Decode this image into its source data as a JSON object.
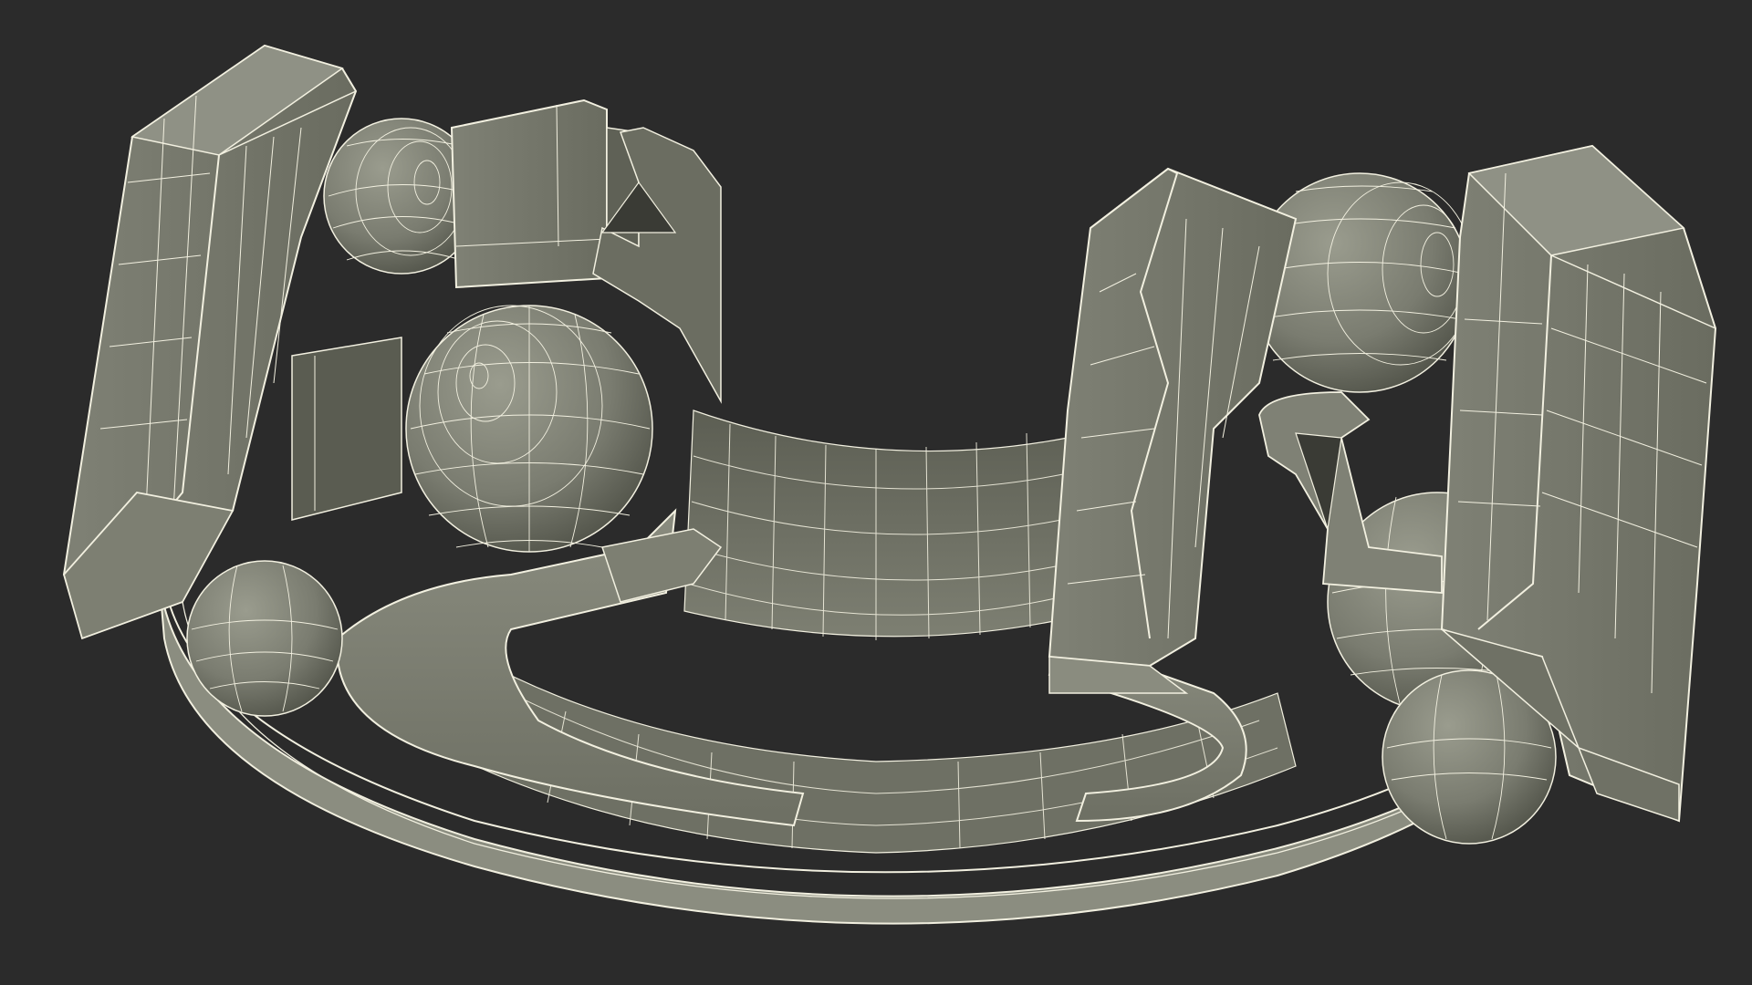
{
  "scene": {
    "subject": "bearing-cage-segment-wireframe",
    "background_color": "#2b2b2b",
    "surface_color": "#7a7b6f",
    "surface_light_color": "#8d8f82",
    "surface_dark_color": "#55574c",
    "wire_color": "#f2f0e0"
  }
}
